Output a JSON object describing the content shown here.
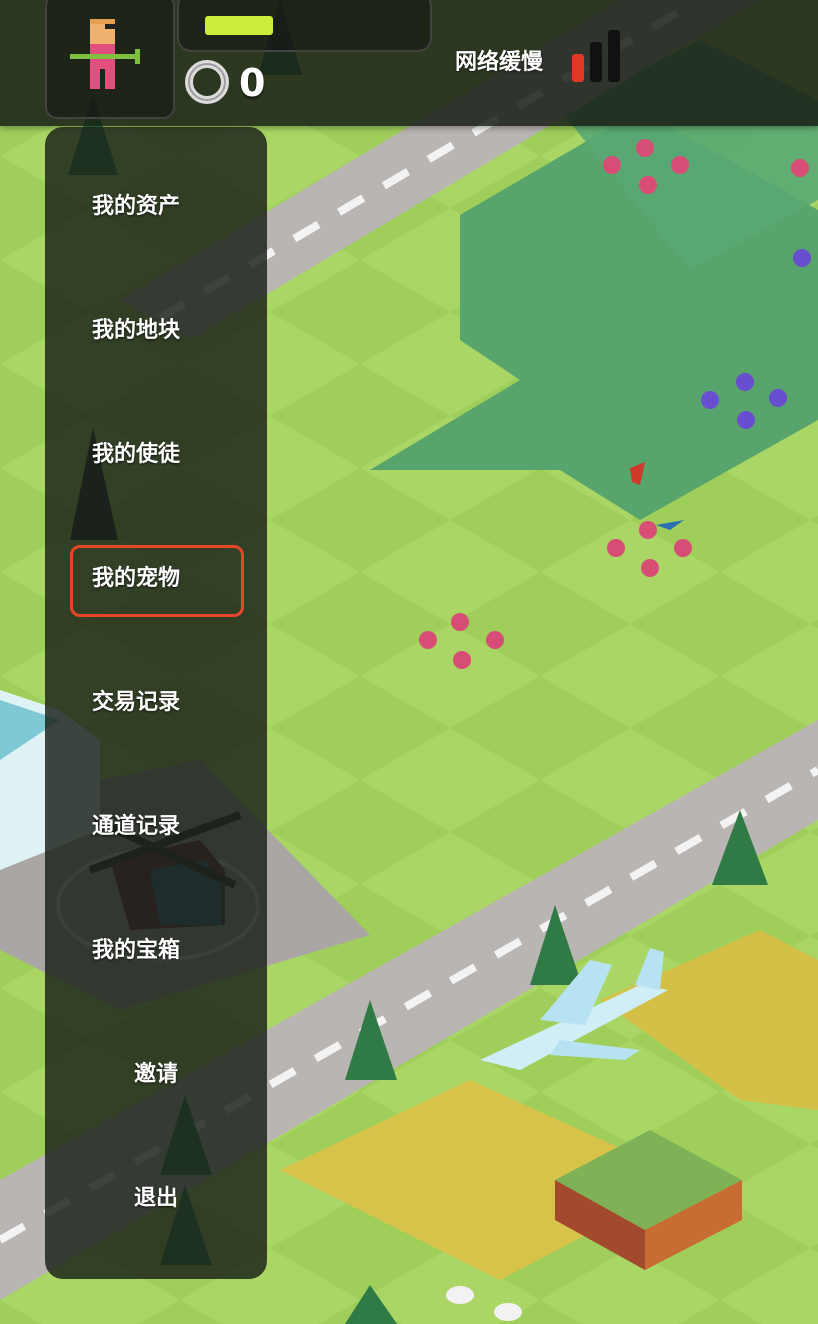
{
  "colors": {
    "accent_highlight": "#e6452a",
    "energy_fill": "#cbee3a",
    "signal_active": "#e03a24",
    "signal_inactive": "#111111",
    "hud_background": "#181e16"
  },
  "hud": {
    "avatar": {
      "icon": "pixel-character-with-gun-icon"
    },
    "energy": {
      "level": 0.34
    },
    "coins": {
      "icon": "silver-coin-icon",
      "count": "0"
    },
    "network": {
      "status_text": "网络缓慢",
      "signal_bars_total": 3,
      "signal_bars_active": 1,
      "icon": "signal-strength-icon"
    }
  },
  "menu": {
    "items": [
      {
        "id": "assets",
        "label": "我的资产"
      },
      {
        "id": "land",
        "label": "我的地块"
      },
      {
        "id": "apprentices",
        "label": "我的使徒"
      },
      {
        "id": "pets",
        "label": "我的宠物",
        "highlighted": true
      },
      {
        "id": "transactions",
        "label": "交易记录"
      },
      {
        "id": "channel",
        "label": "通道记录"
      },
      {
        "id": "chests",
        "label": "我的宝箱"
      },
      {
        "id": "invite",
        "label": "邀请"
      },
      {
        "id": "logout",
        "label": "退出"
      }
    ]
  },
  "scene": {
    "objects": [
      "flower-cluster",
      "pine-tree",
      "airplane",
      "helicopter",
      "road",
      "wheat-field",
      "sheep",
      "building"
    ]
  }
}
